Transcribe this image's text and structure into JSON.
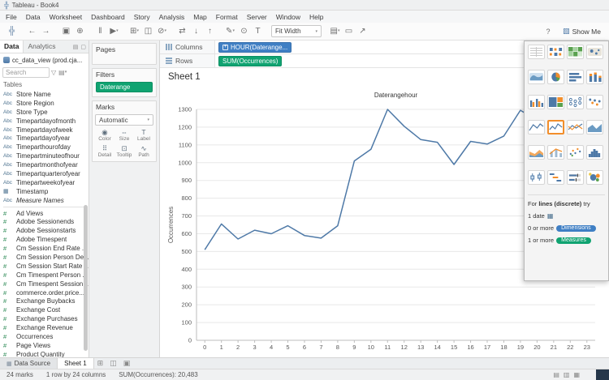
{
  "window": {
    "title": "Tableau - Book4"
  },
  "menubar": {
    "items": [
      "File",
      "Data",
      "Worksheet",
      "Dashboard",
      "Story",
      "Analysis",
      "Map",
      "Format",
      "Server",
      "Window",
      "Help"
    ]
  },
  "toolbar": {
    "icons_left": [
      {
        "name": "tableau-logo-icon",
        "glyph": "╬",
        "color": "#5b7da0"
      },
      {
        "name": "undo-icon",
        "glyph": "←",
        "gap": true
      },
      {
        "name": "redo-icon",
        "glyph": "→"
      },
      {
        "name": "save-icon",
        "glyph": "▣",
        "gap": true
      },
      {
        "name": "new-datasource-icon",
        "glyph": "⊕"
      },
      {
        "name": "pause-updates-icon",
        "glyph": "‖",
        "gap": true
      },
      {
        "name": "run-updates-icon",
        "glyph": "▶",
        "caret": true
      },
      {
        "name": "new-worksheet-icon",
        "glyph": "⊞",
        "caret": true,
        "gap": true
      },
      {
        "name": "duplicate-sheet-icon",
        "glyph": "◫"
      },
      {
        "name": "clear-sheet-icon",
        "glyph": "⊘",
        "caret": true
      },
      {
        "name": "swap-axes-icon",
        "glyph": "⇄",
        "gap": true
      },
      {
        "name": "sort-ascending-icon",
        "glyph": "↓"
      },
      {
        "name": "sort-descending-icon",
        "glyph": "↑"
      },
      {
        "name": "highlight-icon",
        "glyph": "✎",
        "caret": true,
        "gap": true
      },
      {
        "name": "group-members-icon",
        "glyph": "⊙"
      },
      {
        "name": "show-mark-labels-icon",
        "glyph": "T"
      }
    ],
    "fit_label": "Fit Width",
    "icons_right": [
      {
        "name": "show-hide-cards-icon",
        "glyph": "▤",
        "caret": true
      },
      {
        "name": "presentation-mode-icon",
        "glyph": "▭"
      },
      {
        "name": "share-workbook-icon",
        "glyph": "↗"
      }
    ],
    "help_glyph": "?",
    "show_me_icon": "▧",
    "show_me_label": "Show Me"
  },
  "data_pane": {
    "tabs": [
      {
        "label": "Data",
        "active": true
      },
      {
        "label": "Analytics"
      }
    ],
    "pane_icons": [
      {
        "name": "pane-view-icon",
        "glyph": "▤"
      },
      {
        "name": "pane-options-icon",
        "glyph": "▢"
      }
    ],
    "connection": "cc_data_view (prod.cja...",
    "search_placeholder": "Search",
    "search_icons": [
      {
        "name": "filter-icon",
        "glyph": "▽"
      },
      {
        "name": "view-options-icon",
        "glyph": "▤",
        "caret": true
      }
    ],
    "tables_header": "Tables",
    "fields": [
      {
        "name": "Store Name",
        "type": "abc"
      },
      {
        "name": "Store Region",
        "type": "abc"
      },
      {
        "name": "Store Type",
        "type": "abc"
      },
      {
        "name": "Timepartdayofmonth",
        "type": "abc"
      },
      {
        "name": "Timepartdayofweek",
        "type": "abc"
      },
      {
        "name": "Timepartdayofyear",
        "type": "abc"
      },
      {
        "name": "Timeparthourofday",
        "type": "abc"
      },
      {
        "name": "Timepartminuteofhour",
        "type": "abc"
      },
      {
        "name": "Timepartmonthofyear",
        "type": "abc"
      },
      {
        "name": "Timepartquarterofyear",
        "type": "abc"
      },
      {
        "name": "Timepartweekofyear",
        "type": "abc"
      },
      {
        "name": "Timestamp",
        "type": "date"
      },
      {
        "name": "Measure Names",
        "type": "abc",
        "italic": true,
        "divider_after": true
      },
      {
        "name": "Ad Views",
        "type": "num"
      },
      {
        "name": "Adobe Sessionends",
        "type": "num"
      },
      {
        "name": "Adobe Sessionstarts",
        "type": "num"
      },
      {
        "name": "Adobe Timespent",
        "type": "num"
      },
      {
        "name": "Cm Session End Rate ...",
        "type": "num"
      },
      {
        "name": "Cm Session Person De...",
        "type": "num"
      },
      {
        "name": "Cm Session Start Rate ...",
        "type": "num"
      },
      {
        "name": "Cm Timespent Person ...",
        "type": "num"
      },
      {
        "name": "Cm Timespent Session...",
        "type": "num"
      },
      {
        "name": "commerce.order.price...",
        "type": "num"
      },
      {
        "name": "Exchange Buybacks",
        "type": "num"
      },
      {
        "name": "Exchange Cost",
        "type": "num"
      },
      {
        "name": "Exchange Purchases",
        "type": "num"
      },
      {
        "name": "Exchange Revenue",
        "type": "num"
      },
      {
        "name": "Occurrences",
        "type": "num"
      },
      {
        "name": "Page Views",
        "type": "num"
      },
      {
        "name": "Product Quantity",
        "type": "num"
      }
    ]
  },
  "cards": {
    "pages": {
      "title": "Pages"
    },
    "filters": {
      "title": "Filters",
      "pills": [
        {
          "label": "Daterange",
          "color": "green"
        }
      ]
    },
    "marks": {
      "title": "Marks",
      "type_selector": "Automatic",
      "buttons": [
        {
          "label": "Color",
          "icon": "color-icon",
          "glyph": "◉"
        },
        {
          "label": "Size",
          "icon": "size-icon",
          "glyph": "⇔"
        },
        {
          "label": "Label",
          "icon": "label-icon",
          "glyph": "T"
        },
        {
          "label": "Detail",
          "icon": "detail-icon",
          "glyph": "⠿"
        },
        {
          "label": "Tooltip",
          "icon": "tooltip-icon",
          "glyph": "⊡"
        },
        {
          "label": "Path",
          "icon": "path-icon",
          "glyph": "∿"
        }
      ]
    }
  },
  "shelves": {
    "columns_label": "Columns",
    "rows_label": "Rows",
    "columns_pills": [
      {
        "label": "HOUR(Daterange...",
        "color": "blue",
        "plus": true
      }
    ],
    "rows_pills": [
      {
        "label": "SUM(Occurrences)",
        "color": "green"
      }
    ]
  },
  "sheet": {
    "title": "Sheet 1"
  },
  "chart_data": {
    "type": "line",
    "title": "Daterangehour",
    "ylabel": "Occurrences",
    "series_name": "SUM(Occurrences)",
    "x": [
      0,
      1,
      2,
      3,
      4,
      5,
      6,
      7,
      8,
      9,
      10,
      11,
      12,
      13,
      14,
      15,
      16,
      17,
      18,
      19,
      20,
      21,
      22,
      23
    ],
    "values": [
      510,
      655,
      570,
      620,
      600,
      645,
      590,
      575,
      645,
      1010,
      1075,
      1300,
      1205,
      1130,
      1115,
      990,
      1120,
      1105,
      1150,
      1295,
      1240,
      1130,
      1010,
      1000
    ],
    "ylim": [
      0,
      1300
    ],
    "yticks": [
      0,
      100,
      200,
      300,
      400,
      500,
      600,
      700,
      800,
      900,
      1000,
      1100,
      1200,
      1300
    ],
    "line_color": "#4e79a7",
    "grid": true,
    "legend": "none"
  },
  "show_me": {
    "hint": {
      "prefix": "For",
      "emphasis": "lines (discrete)",
      "suffix": "try"
    },
    "requirements": [
      {
        "text": "1 date",
        "icon": "calendar-icon"
      },
      {
        "text": "0 or more",
        "badge": "Dimensions",
        "badge_color": "#3f7fc4"
      },
      {
        "text": "1 or more",
        "badge": "Measures",
        "badge_color": "#10a371"
      }
    ],
    "selected_index": 13,
    "thumbnails": [
      {
        "name": "text-tables",
        "kind": "text-table"
      },
      {
        "name": "heat-map",
        "kind": "heatmap"
      },
      {
        "name": "highlight-table",
        "kind": "highlight-table"
      },
      {
        "name": "symbol-maps",
        "kind": "symbol-map"
      },
      {
        "name": "filled-maps",
        "kind": "filled-map"
      },
      {
        "name": "pie-chart",
        "kind": "pie"
      },
      {
        "name": "horizontal-bars",
        "kind": "hbars"
      },
      {
        "name": "stacked-bars",
        "kind": "stacked-bars"
      },
      {
        "name": "side-by-side-bars",
        "kind": "side-bars"
      },
      {
        "name": "treemap",
        "kind": "treemap"
      },
      {
        "name": "circle-views",
        "kind": "circles"
      },
      {
        "name": "side-by-side-circles",
        "kind": "side-circles"
      },
      {
        "name": "continuous-lines",
        "kind": "line"
      },
      {
        "name": "discrete-lines",
        "kind": "line2"
      },
      {
        "name": "dual-lines",
        "kind": "dual-line"
      },
      {
        "name": "area-charts-continuous",
        "kind": "area"
      },
      {
        "name": "area-charts-discrete",
        "kind": "area2"
      },
      {
        "name": "dual-combination",
        "kind": "combo"
      },
      {
        "name": "scatter-plots",
        "kind": "scatter"
      },
      {
        "name": "histogram",
        "kind": "histogram"
      },
      {
        "name": "box-and-whisker",
        "kind": "box"
      },
      {
        "name": "gantt",
        "kind": "gantt"
      },
      {
        "name": "bullet-graphs",
        "kind": "bullet"
      },
      {
        "name": "packed-bubbles",
        "kind": "bubbles"
      }
    ]
  },
  "bottom": {
    "tabs": [
      {
        "label": "Data Source",
        "icon": "datasource-grid-icon"
      },
      {
        "label": "Sheet 1",
        "active": true
      }
    ],
    "new_buttons": [
      {
        "name": "new-worksheet-button",
        "glyph": "⊞"
      },
      {
        "name": "new-dashboard-button",
        "glyph": "◫"
      },
      {
        "name": "new-story-button",
        "glyph": "▣"
      }
    ],
    "status": {
      "marks": "24 marks",
      "size": "1 row by 24 columns",
      "aggregate": "SUM(Occurrences): 20,483"
    },
    "right_icons": [
      {
        "name": "show-tabs-icon",
        "glyph": "▤"
      },
      {
        "name": "show-filmstrip-icon",
        "glyph": "▥"
      },
      {
        "name": "show-sheet-sorter-icon",
        "glyph": "▦"
      }
    ]
  }
}
